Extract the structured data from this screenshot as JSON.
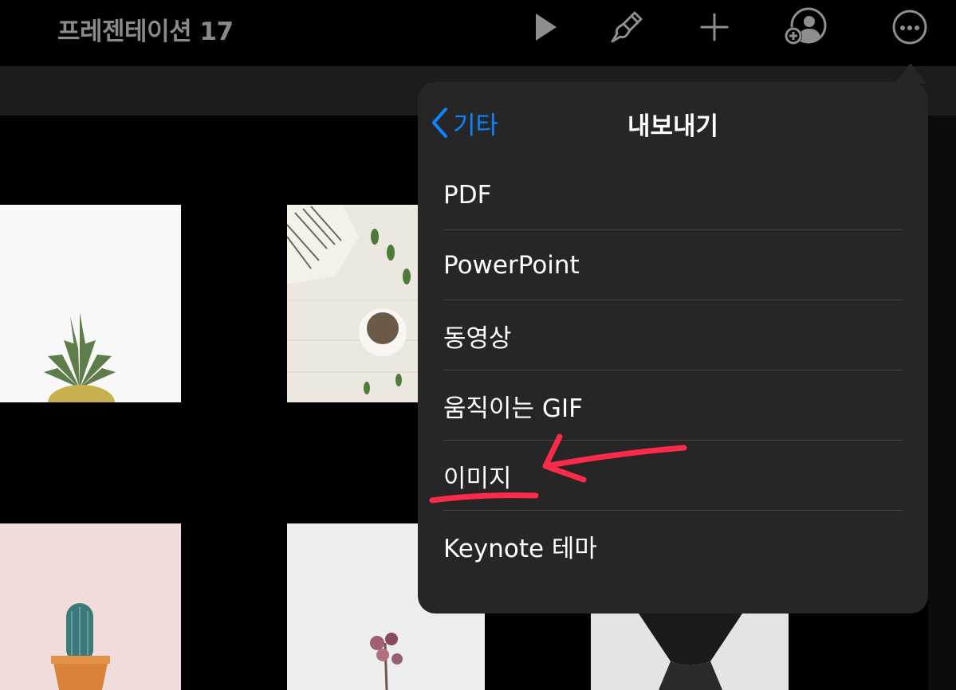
{
  "toolbar": {
    "title": "프레젠테이션 17",
    "icons": [
      "play-icon",
      "format-brush-icon",
      "add-icon",
      "collaborate-icon",
      "more-icon"
    ]
  },
  "popover": {
    "back_label": "기타",
    "title": "내보내기",
    "items": [
      {
        "label": "PDF"
      },
      {
        "label": "PowerPoint"
      },
      {
        "label": "동영상"
      },
      {
        "label": "움직이는 GIF"
      },
      {
        "label": "이미지"
      },
      {
        "label": "Keynote 테마"
      }
    ]
  },
  "colors": {
    "accent": "#0a84ff",
    "popover_bg": "#262626",
    "annotation": "#ff2a4a"
  },
  "thumbnails": [
    "pineapple-photo",
    "herbs-bowl-photo",
    "cactus-photo",
    "dried-roses-photo",
    "black-tulle-photo"
  ]
}
